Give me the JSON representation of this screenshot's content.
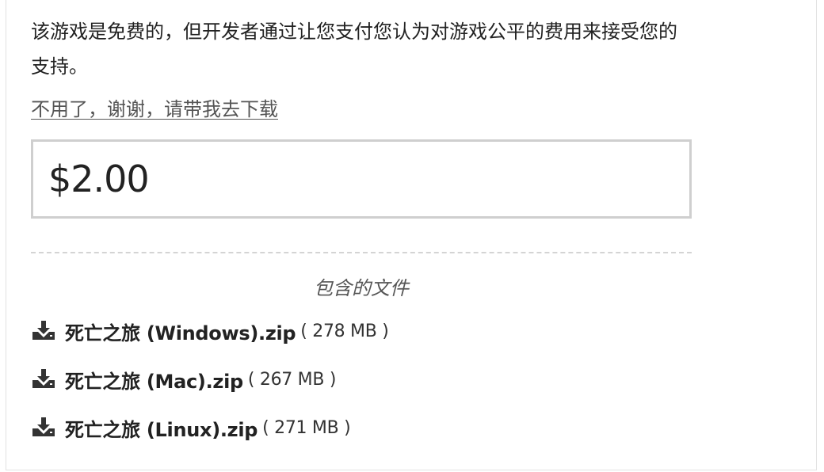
{
  "intro_text": "该游戏是免费的，但开发者通过让您支付您认为对游戏公平的费用来接受您的支持。",
  "skip_link": "不用了，谢谢，请带我去下载",
  "price": {
    "value": "$2.00"
  },
  "files_heading": "包含的文件",
  "files": [
    {
      "name": "死亡之旅 (Windows).zip",
      "size": "( 278 MB )",
      "icon": "download-icon"
    },
    {
      "name": "死亡之旅 (Mac).zip",
      "size": "( 267 MB )",
      "icon": "download-icon"
    },
    {
      "name": "死亡之旅 (Linux).zip",
      "size": "( 271 MB )",
      "icon": "download-icon"
    }
  ]
}
